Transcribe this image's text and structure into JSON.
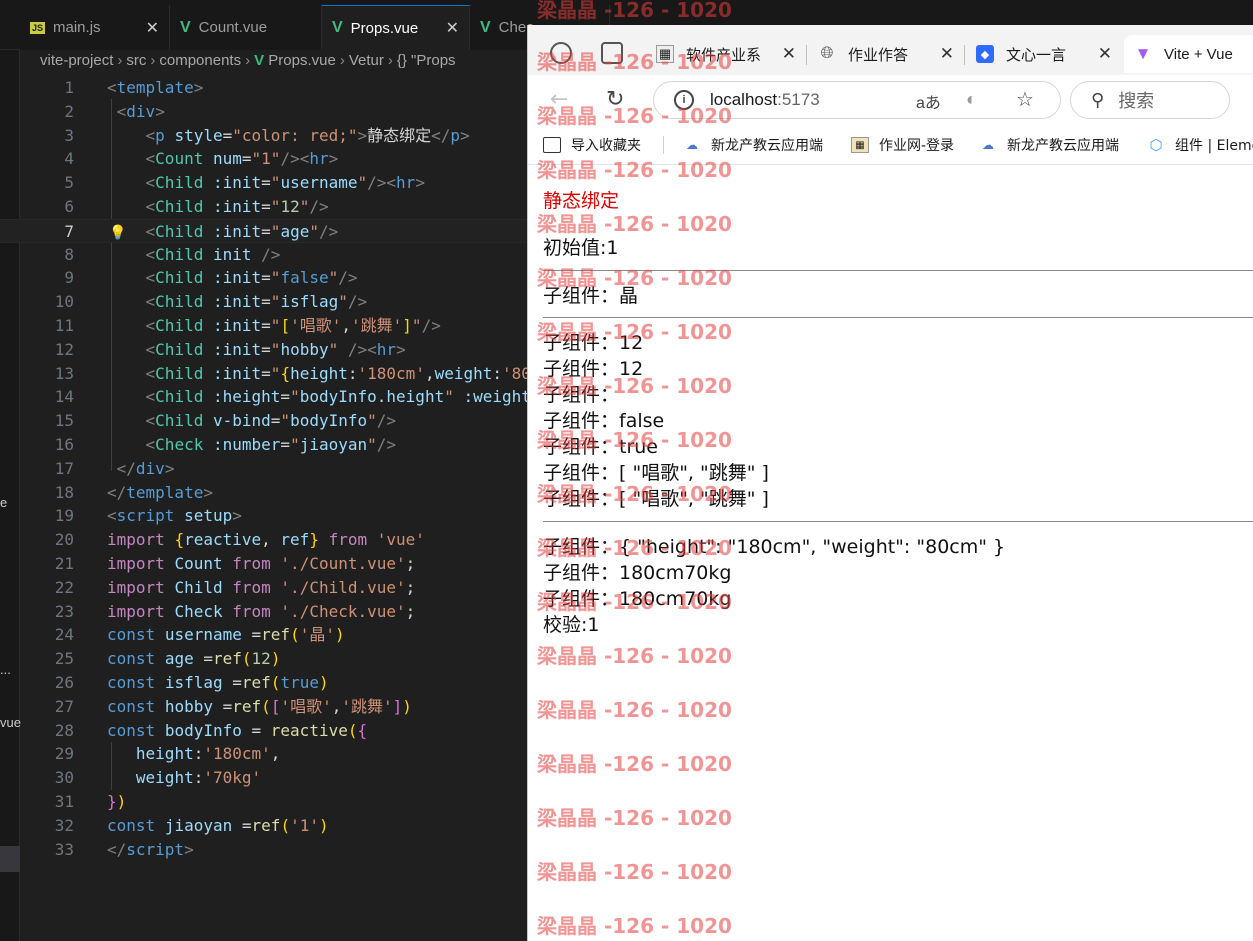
{
  "editor": {
    "tabs": [
      {
        "label": "main.js",
        "icon": "js",
        "active": false
      },
      {
        "label": "Count.vue",
        "icon": "vue",
        "active": false
      },
      {
        "label": "Props.vue",
        "icon": "vue",
        "active": true
      },
      {
        "label": "Chec",
        "icon": "vue",
        "active": false
      }
    ],
    "close_glyph": "✕",
    "breadcrumb": [
      "vite-project",
      "src",
      "components",
      "Props.vue",
      "Vetur",
      "{} \"Props"
    ],
    "current_line": 7,
    "left_strip": {
      "e": "e",
      "dots": "...",
      "vue": "vue"
    }
  },
  "browser": {
    "tabs": [
      {
        "label": "软件产业系",
        "favicon": "image"
      },
      {
        "label": "作业作答",
        "favicon": "globe"
      },
      {
        "label": "文心一言",
        "favicon": "cube"
      },
      {
        "label": "Vite + Vue",
        "favicon": "vite"
      }
    ],
    "address": {
      "host": "localhost",
      "port": ":5173"
    },
    "search_placeholder": "搜索",
    "bookmarks": [
      {
        "label": "导入收藏夹",
        "icon": "folder"
      },
      {
        "label": "新龙产教云应用端",
        "icon": "cloud"
      },
      {
        "label": "作业网-登录",
        "icon": "image"
      },
      {
        "label": "新龙产教云应用端",
        "icon": "cloud"
      },
      {
        "label": "组件 | Eleme",
        "icon": "element"
      }
    ]
  },
  "page": {
    "static_binding": "静态绑定",
    "initial_value": "初始值:1",
    "child_lines_1": [
      "子组件：晶"
    ],
    "child_lines_2": [
      "子组件：12",
      "子组件：12",
      "子组件：",
      "子组件：false",
      "子组件：true",
      "子组件：[ \"唱歌\", \"跳舞\" ]",
      "子组件：[ \"唱歌\", \"跳舞\" ]"
    ],
    "child_lines_3": [
      "子组件：{ \"height\": \"180cm\", \"weight\": \"80cm\" }",
      "子组件：180cm70kg",
      "子组件：180cm70kg"
    ],
    "check": "校验:1"
  },
  "watermark": "梁晶晶 -126 - 1020"
}
